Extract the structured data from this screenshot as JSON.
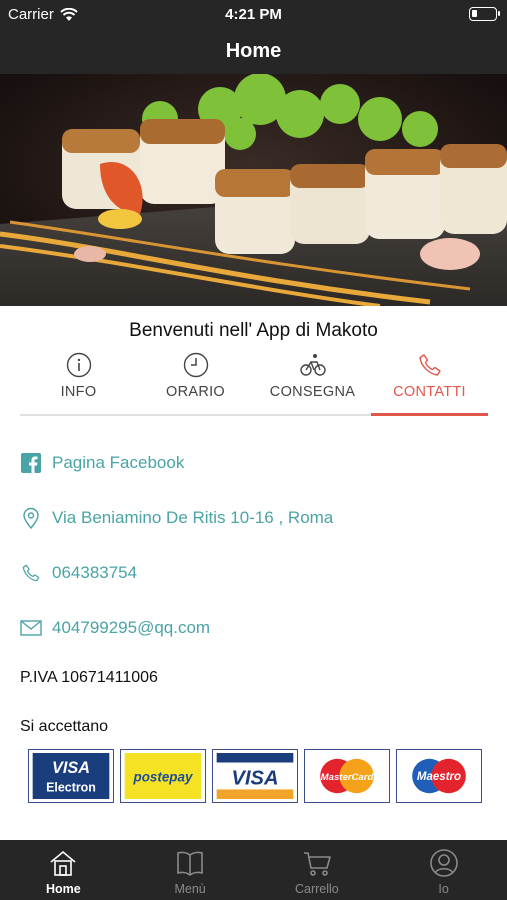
{
  "status_bar": {
    "carrier": "Carrier",
    "time": "4:21 PM"
  },
  "nav": {
    "title": "Home"
  },
  "hero": {
    "pages": 1,
    "active_page": 1,
    "accent": "#1e88e5"
  },
  "welcome": "Benvenuti nell' App di Makoto",
  "tabs": [
    {
      "label": "INFO",
      "icon": "info-icon",
      "active": false
    },
    {
      "label": "ORARIO",
      "icon": "clock-icon",
      "active": false
    },
    {
      "label": "CONSEGNA",
      "icon": "bicycle-icon",
      "active": false
    },
    {
      "label": "CONTATTI",
      "icon": "phone-icon",
      "active": true
    }
  ],
  "contacts": {
    "facebook": "Pagina Facebook",
    "address": "Via Beniamino De Ritis 10-16 , Roma",
    "phone": "064383754",
    "email": "404799295@qq.com"
  },
  "piva": "P.IVA 10671411006",
  "accept_label": "Si accettano",
  "payment_cards": [
    {
      "name": "VISA Electron",
      "line1": "VISA",
      "line2": "Electron"
    },
    {
      "name": "postepay",
      "line1": "postepay"
    },
    {
      "name": "VISA",
      "line1": "VISA"
    },
    {
      "name": "MasterCard",
      "line1": "MasterCard"
    },
    {
      "name": "Maestro",
      "line1": "Maestro"
    }
  ],
  "tab_bar": [
    {
      "label": "Home",
      "icon": "home-icon",
      "active": true
    },
    {
      "label": "Menù",
      "icon": "book-icon",
      "active": false
    },
    {
      "label": "Carrello",
      "icon": "cart-icon",
      "active": false
    },
    {
      "label": "Io",
      "icon": "user-icon",
      "active": false
    }
  ],
  "colors": {
    "accent_red": "#e2574c",
    "link_teal": "#4aa3a6",
    "bar_dark": "#262626"
  }
}
